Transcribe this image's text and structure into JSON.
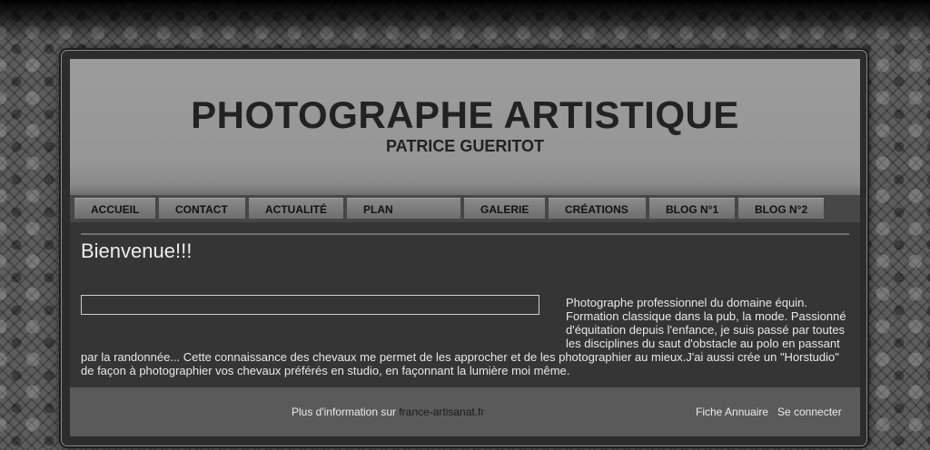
{
  "header": {
    "title": "PHOTOGRAPHE ARTISTIQUE",
    "subtitle": "PATRICE GUERITOT"
  },
  "nav": {
    "items": [
      {
        "label": "ACCUEIL"
      },
      {
        "label": "CONTACT"
      },
      {
        "label": "ACTUALITÉ"
      },
      {
        "label": "PLAN"
      },
      {
        "label": "GALERIE"
      },
      {
        "label": "CRÉATIONS"
      },
      {
        "label": "BLOG N°1"
      },
      {
        "label": "BLOG N°2"
      }
    ]
  },
  "content": {
    "heading": "Bienvenue!!!",
    "paragraph": "Photographe professionnel du domaine équin. Formation classique dans la pub, la mode. Passionné d'équitation depuis l'enfance, je suis passé par toutes les disciplines du saut d'obstacle au polo en passant par la randonnée... Cette connaissance des chevaux me permet de les approcher et de les photographier au mieux.J'ai aussi crée un \"Horstudio\" de façon à photographier vos chevaux préférés en studio, en façonnant la lumière moi même."
  },
  "footer": {
    "info_prefix": "Plus d'information sur ",
    "info_link": "france-artisanat.fr",
    "directory_link": "Fiche Annuaire",
    "login_link": "Se connecter"
  }
}
